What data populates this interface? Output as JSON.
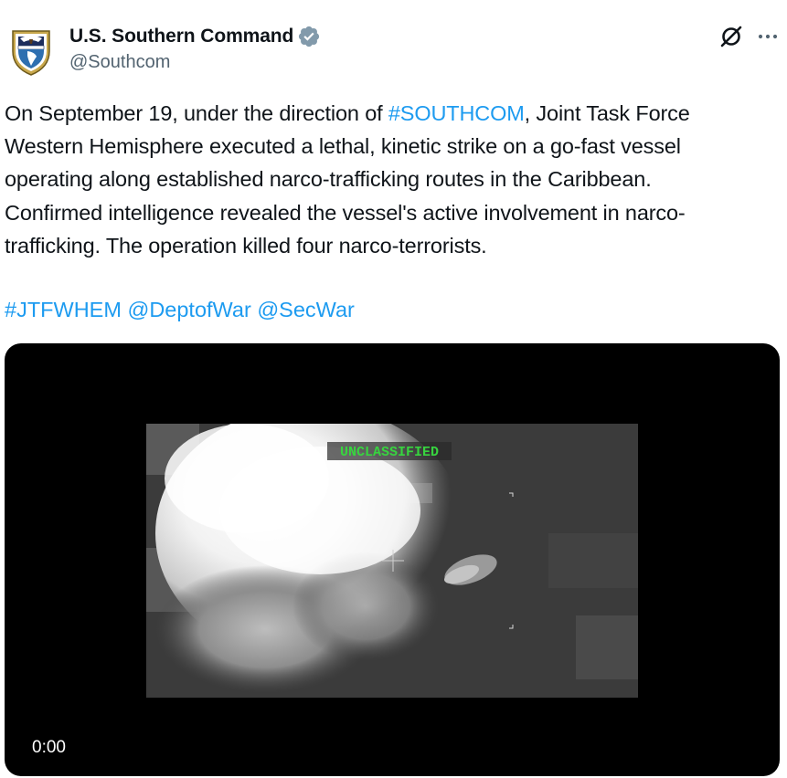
{
  "author": {
    "display_name": "U.S. Southern Command",
    "handle": "@Southcom",
    "verified_color": "#829aab"
  },
  "tweet": {
    "lines": [
      [
        {
          "t": "On September 19, under the direction of "
        },
        {
          "t": "#SOUTHCOM",
          "link": true
        },
        {
          "t": ", Joint Task Force"
        }
      ],
      [
        {
          "t": "Western Hemisphere executed a lethal, kinetic strike on a go-fast vessel"
        }
      ],
      [
        {
          "t": "operating along established narco-trafficking routes in the Caribbean."
        }
      ],
      [
        {
          "t": "Confirmed intelligence revealed the vessel's active involvement in narco-"
        }
      ],
      [
        {
          "t": "trafficking. The operation killed four narco-terrorists."
        }
      ]
    ],
    "tags": [
      "#JTFWHEM",
      "@DeptofWar",
      "@SecWar"
    ]
  },
  "video": {
    "overlay_label": "UNCLASSIFIED",
    "timestamp": "0:00"
  },
  "icons": {
    "grok": "grok-icon",
    "more": "more-options-icon",
    "verified": "verified-badge-icon"
  },
  "colors": {
    "link": "#1d9bf0",
    "text": "#0f1419",
    "secondary": "#536471"
  }
}
